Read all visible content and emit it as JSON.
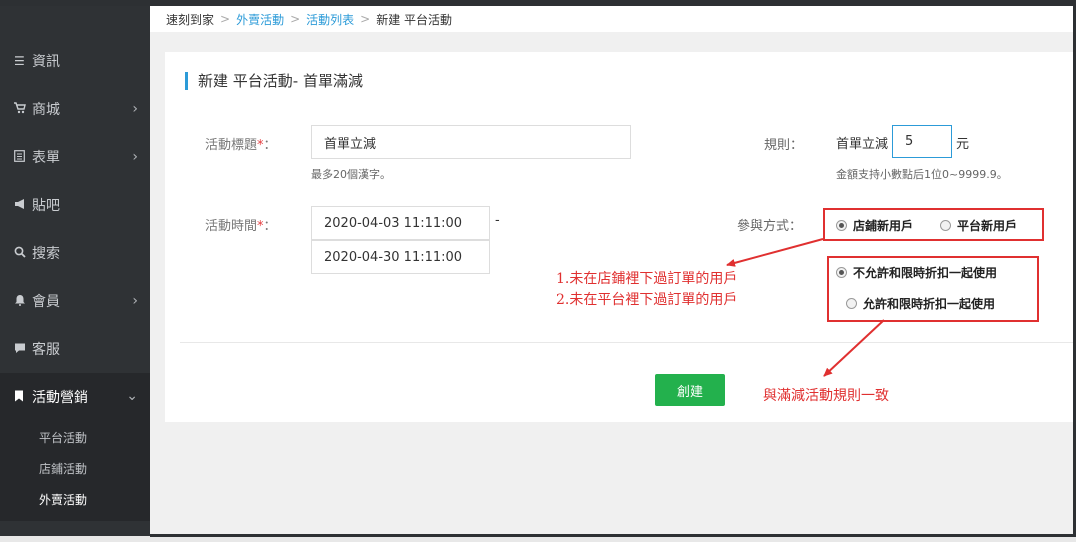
{
  "breadcrumb": {
    "home": "速刻到家",
    "level1": "外賣活動",
    "level2": "活動列表",
    "current": "新建 平台活動"
  },
  "sidebar": {
    "items": [
      {
        "label": "資訊",
        "icon": "list-icon"
      },
      {
        "label": "商城",
        "icon": "cart-icon"
      },
      {
        "label": "表單",
        "icon": "form-icon"
      },
      {
        "label": "貼吧",
        "icon": "megaphone-icon"
      },
      {
        "label": "搜索",
        "icon": "search-icon"
      },
      {
        "label": "會員",
        "icon": "bell-icon"
      },
      {
        "label": "客服",
        "icon": "chat-icon"
      },
      {
        "label": "活動營銷",
        "icon": "bookmark-icon"
      }
    ],
    "sub_items": [
      "平台活動",
      "店鋪活動",
      "外賣活動"
    ]
  },
  "form": {
    "title": "新建 平台活動- 首單滿減",
    "title_label": "活動標題",
    "title_value": "首單立減",
    "title_hint": "最多20個漢字。",
    "time_label": "活動時間",
    "start_time": "2020-04-03 11:11:00",
    "end_time": "2020-04-30 11:11:00",
    "time_dash": "-",
    "required_mark": "*",
    "colon": "：",
    "rule_label": "規則：",
    "rule_prefix": "首單立減",
    "rule_value": "5",
    "rule_unit": "元",
    "rule_hint": "金額支持小數點后1位0~9999.9。",
    "participation_label": "參與方式：",
    "participation_options": [
      "店鋪新用戶",
      "平台新用戶"
    ],
    "discount_options": [
      "不允許和限時折扣一起使用",
      "允許和限時折扣一起使用"
    ],
    "create_button": "創建"
  },
  "annotations": {
    "note1": "1.未在店鋪裡下過訂單的用戶",
    "note2": "2.未在平台裡下過訂單的用戶",
    "note3": "與滿減活動規則一致"
  },
  "colors": {
    "sidebar_bg": "#2f3235",
    "accent": "#2c9bd8",
    "create_button": "#23b14d",
    "annotation_red": "#e03030"
  }
}
